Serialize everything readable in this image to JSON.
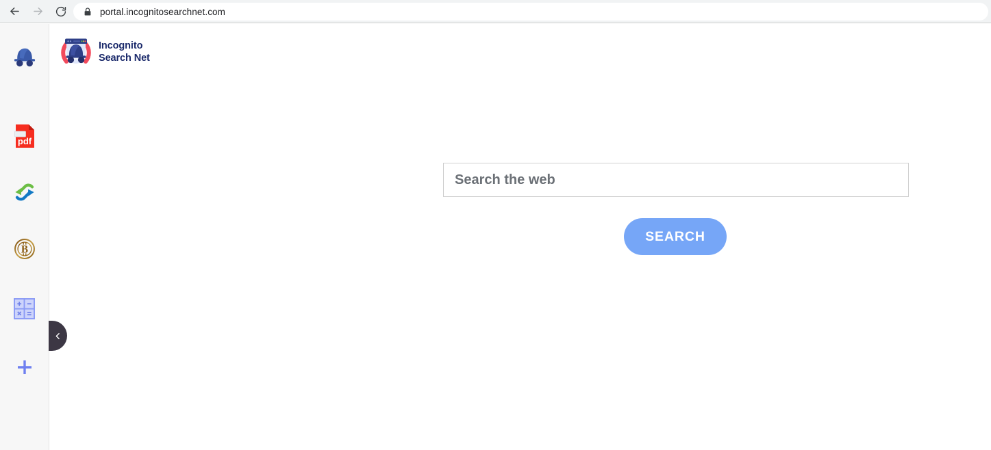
{
  "browser": {
    "back_label": "Back",
    "forward_label": "Forward",
    "reload_label": "Reload",
    "lock_icon": "lock-icon",
    "url": "portal.incognitosearchnet.com"
  },
  "sidebar": {
    "items": [
      {
        "name": "incognito-hat-icon",
        "label": "Incognito Search Net"
      },
      {
        "name": "pdf-file-icon",
        "label": "pdf"
      },
      {
        "name": "convert-arrows-icon",
        "label": "Convert"
      },
      {
        "name": "bitcoin-icon",
        "label": "Bitcoin"
      },
      {
        "name": "calculator-icon",
        "label": "Calculator"
      },
      {
        "name": "plus-icon",
        "label": "Add"
      }
    ],
    "collapse_icon": "chevron-left-icon"
  },
  "brand": {
    "logo_icon": "incognito-browser-logo",
    "line1": "Incognito",
    "line2": "Search Net"
  },
  "search": {
    "value": "",
    "placeholder": "Search the web",
    "button_label": "SEARCH"
  },
  "colors": {
    "accent_blue": "#76a6f7",
    "brand_navy": "#1b2a6b",
    "sidebar_bg": "#f7f7f7",
    "chrome_bg": "#f1f3f4",
    "collapse_tab": "#3c3744",
    "pdf_red": "#f62d1f",
    "convert_green": "#6cbe45",
    "convert_blue": "#1279c4",
    "bitcoin_gold": "#9a6a16",
    "calculator_blue": "#8b9bf5"
  }
}
